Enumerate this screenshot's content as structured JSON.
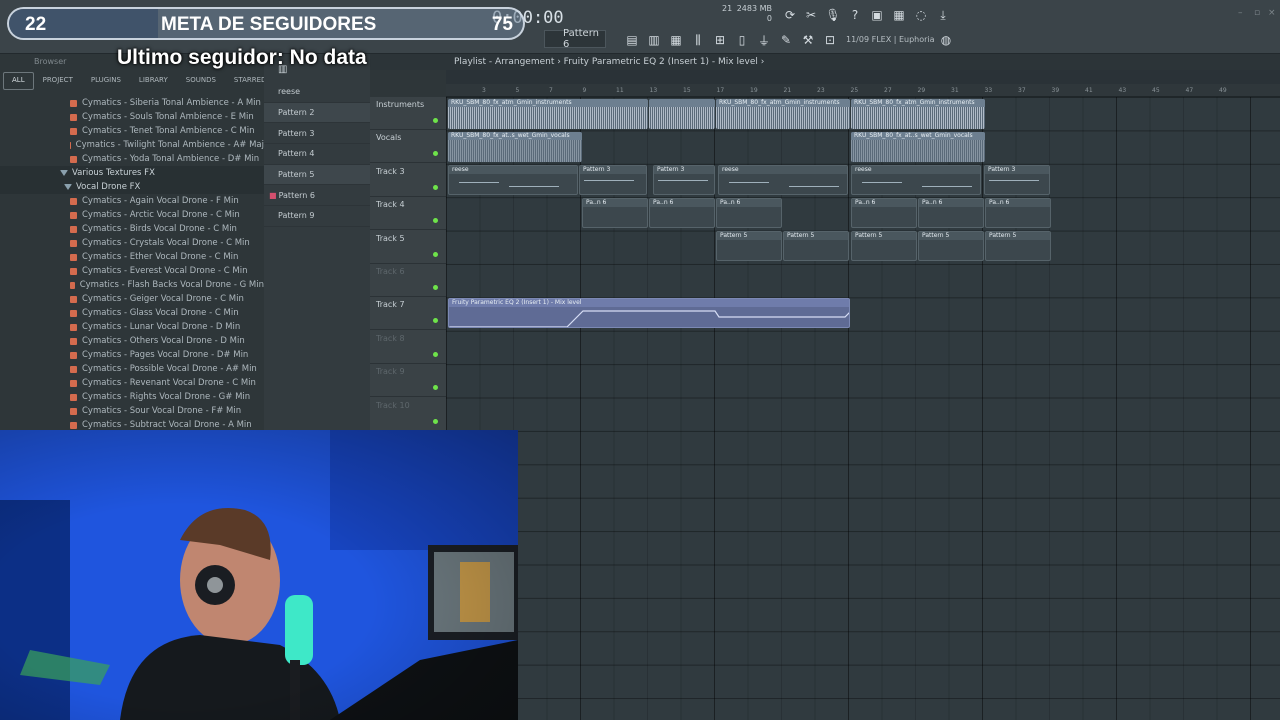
{
  "overlay": {
    "goal_current": "22",
    "goal_label": "META DE SEGUIDORES",
    "goal_target": "75",
    "goal_progress_fraction": 0.29,
    "last_follower": "Ultimo seguidor: No data"
  },
  "toolbar": {
    "time": "0:00:00",
    "pattern": "Pattern 6",
    "mem_mb": "2483 MB",
    "cpu": "21",
    "mem_sub": "0",
    "flex_info": "11/09 FLEX | Euphoria"
  },
  "browser": {
    "title": "Browser",
    "tabs": [
      "ALL",
      "PROJECT",
      "PLUGINS",
      "LIBRARY",
      "SOUNDS",
      "STARRED"
    ],
    "items_top": [
      "Cymatics - Siberia Tonal Ambience - A Min",
      "Cymatics - Souls Tonal Ambience - E Min",
      "Cymatics - Tenet Tonal Ambience - C Min",
      "Cymatics - Twilight Tonal Ambience - A# Maj",
      "Cymatics - Yoda Tonal Ambience - D# Min"
    ],
    "folder_1": "Various Textures FX",
    "folder_2": "Vocal Drone FX",
    "items_bottom": [
      "Cymatics - Again Vocal Drone - F Min",
      "Cymatics - Arctic Vocal Drone - C Min",
      "Cymatics - Birds Vocal Drone - C Min",
      "Cymatics - Crystals Vocal Drone - C Min",
      "Cymatics - Ether Vocal Drone - C Min",
      "Cymatics - Everest Vocal Drone - C Min",
      "Cymatics - Flash Backs Vocal Drone - G Min",
      "Cymatics - Geiger Vocal Drone - C Min",
      "Cymatics - Glass Vocal Drone - C Min",
      "Cymatics - Lunar Vocal Drone - D Min",
      "Cymatics - Others Vocal Drone - D Min",
      "Cymatics - Pages Vocal Drone - D# Min",
      "Cymatics - Possible Vocal Drone - A# Min",
      "Cymatics - Revenant Vocal Drone - C Min",
      "Cymatics - Rights Vocal Drone - G# Min",
      "Cymatics - Sour Vocal Drone - F# Min",
      "Cymatics - Subtract Vocal Drone - A Min"
    ]
  },
  "patterns": [
    "reese",
    "Pattern 2",
    "Pattern 3",
    "Pattern 4",
    "Pattern 5",
    "Pattern 6",
    "Pattern 9"
  ],
  "playlist": {
    "breadcrumb": "Playlist - Arrangement › Fruity Parametric EQ 2 (Insert 1) - Mix level ›",
    "ruler": [
      "3",
      "5",
      "7",
      "9",
      "11",
      "13",
      "15",
      "17",
      "19",
      "21",
      "23",
      "25",
      "27",
      "29",
      "31",
      "33",
      "37",
      "39",
      "41",
      "43",
      "45",
      "47",
      "49"
    ],
    "tracks": [
      "Instruments",
      "Vocals",
      "Track 3",
      "Track 4",
      "Track 5",
      "Track 6",
      "Track 7",
      "Track 8",
      "Track 9",
      "Track 10"
    ],
    "clip_instruments": "RKU_SBM_80_fx_atm_Gmin_instruments",
    "clip_vocals": "RKU_SBM_80_fx_at..s_wet_Gmin_vocals",
    "clip_reese": "reese",
    "clip_pattern3": "Pattern 3",
    "clip_pattern5": "Pattern 5",
    "clip_pat6": "Pa..n 6",
    "clip_auto": "Fruity Parametric EQ 2 (Insert 1) - Mix level"
  }
}
